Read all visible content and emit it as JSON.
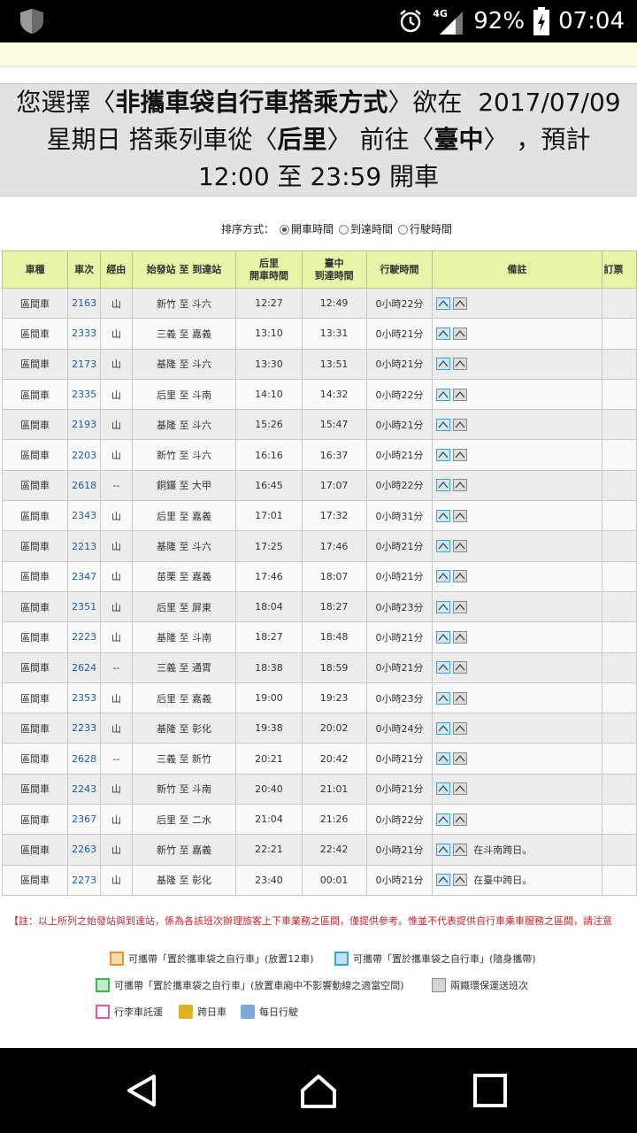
{
  "status_bar": {
    "network": "4G",
    "battery": "92%",
    "time": "07:04"
  },
  "header": {
    "line1_a": "您選擇〈",
    "line1_b": "非攜車袋自行車搭乘方式",
    "line1_c": "〉欲在",
    "date": "2017/07/09",
    "line2_a": "星期日  搭乘列車從〈",
    "from": "后里",
    "line2_b": "〉 前往〈",
    "to": "臺中",
    "line2_c": "〉 ，預計",
    "line3": "12:00  至  23:59  開車"
  },
  "sort": {
    "label": "排序方式：",
    "options": [
      "開車時間",
      "到達時間",
      "行駛時間"
    ],
    "selected": "開車時間"
  },
  "table": {
    "headers": [
      "車種",
      "車次",
      "經由",
      "始發站 至 到達站",
      "后里\n開車時間",
      "臺中\n到達時間",
      "行駛時間",
      "備註",
      "訂票"
    ],
    "rows": [
      {
        "type": "區間車",
        "no": "2163",
        "via": "山",
        "route": "新竹 至 斗六",
        "dep": "12:27",
        "arr": "12:49",
        "dur": "0小時22分",
        "note": ""
      },
      {
        "type": "區間車",
        "no": "2333",
        "via": "山",
        "route": "三義 至 嘉義",
        "dep": "13:10",
        "arr": "13:31",
        "dur": "0小時21分",
        "note": ""
      },
      {
        "type": "區間車",
        "no": "2173",
        "via": "山",
        "route": "基隆 至 斗六",
        "dep": "13:30",
        "arr": "13:51",
        "dur": "0小時21分",
        "note": ""
      },
      {
        "type": "區間車",
        "no": "2335",
        "via": "山",
        "route": "后里 至 斗南",
        "dep": "14:10",
        "arr": "14:32",
        "dur": "0小時22分",
        "note": ""
      },
      {
        "type": "區間車",
        "no": "2193",
        "via": "山",
        "route": "基隆 至 斗六",
        "dep": "15:26",
        "arr": "15:47",
        "dur": "0小時21分",
        "note": ""
      },
      {
        "type": "區間車",
        "no": "2203",
        "via": "山",
        "route": "新竹 至 斗六",
        "dep": "16:16",
        "arr": "16:37",
        "dur": "0小時21分",
        "note": ""
      },
      {
        "type": "區間車",
        "no": "2618",
        "via": "--",
        "route": "銅鑼 至 大甲",
        "dep": "16:45",
        "arr": "17:07",
        "dur": "0小時22分",
        "note": ""
      },
      {
        "type": "區間車",
        "no": "2343",
        "via": "山",
        "route": "后里 至 嘉義",
        "dep": "17:01",
        "arr": "17:32",
        "dur": "0小時31分",
        "note": ""
      },
      {
        "type": "區間車",
        "no": "2213",
        "via": "山",
        "route": "基隆 至 斗六",
        "dep": "17:25",
        "arr": "17:46",
        "dur": "0小時21分",
        "note": ""
      },
      {
        "type": "區間車",
        "no": "2347",
        "via": "山",
        "route": "苗栗 至 嘉義",
        "dep": "17:46",
        "arr": "18:07",
        "dur": "0小時21分",
        "note": ""
      },
      {
        "type": "區間車",
        "no": "2351",
        "via": "山",
        "route": "后里 至 屏東",
        "dep": "18:04",
        "arr": "18:27",
        "dur": "0小時23分",
        "note": ""
      },
      {
        "type": "區間車",
        "no": "2223",
        "via": "山",
        "route": "基隆 至 斗南",
        "dep": "18:27",
        "arr": "18:48",
        "dur": "0小時21分",
        "note": ""
      },
      {
        "type": "區間車",
        "no": "2624",
        "via": "--",
        "route": "三義 至 通霄",
        "dep": "18:38",
        "arr": "18:59",
        "dur": "0小時21分",
        "note": ""
      },
      {
        "type": "區間車",
        "no": "2353",
        "via": "山",
        "route": "后里 至 嘉義",
        "dep": "19:00",
        "arr": "19:23",
        "dur": "0小時23分",
        "note": ""
      },
      {
        "type": "區間車",
        "no": "2233",
        "via": "山",
        "route": "基隆 至 彰化",
        "dep": "19:38",
        "arr": "20:02",
        "dur": "0小時24分",
        "note": ""
      },
      {
        "type": "區間車",
        "no": "2628",
        "via": "--",
        "route": "三義 至 新竹",
        "dep": "20:21",
        "arr": "20:42",
        "dur": "0小時21分",
        "note": ""
      },
      {
        "type": "區間車",
        "no": "2243",
        "via": "山",
        "route": "新竹 至 斗南",
        "dep": "20:40",
        "arr": "21:01",
        "dur": "0小時21分",
        "note": ""
      },
      {
        "type": "區間車",
        "no": "2367",
        "via": "山",
        "route": "后里 至 二水",
        "dep": "21:04",
        "arr": "21:26",
        "dur": "0小時22分",
        "note": ""
      },
      {
        "type": "區間車",
        "no": "2263",
        "via": "山",
        "route": "新竹 至 嘉義",
        "dep": "22:21",
        "arr": "22:42",
        "dur": "0小時21分",
        "note": "在斗南跨日。"
      },
      {
        "type": "區間車",
        "no": "2273",
        "via": "山",
        "route": "基隆 至 彰化",
        "dep": "23:40",
        "arr": "00:01",
        "dur": "0小時21分",
        "note": "在臺中跨日。"
      }
    ]
  },
  "footnote": "【註：以上所列之始發站與到達站，係為各該班次辦理旅客上下車業務之區間，僅提供參考。惟並不代表提供自行車乘車服務之區間，請注意",
  "legend": [
    {
      "label": "可攜帶「置於攜車袋之自行車」(放置12車)",
      "color": "#e8932c"
    },
    {
      "label": "可攜帶「置於攜車袋之自行車」(隨身攜帶)",
      "color": "#3aa3d8"
    },
    {
      "label": "可攜帶「置於攜車袋之自行車」(放置車廂中不影響動線之適當空間)",
      "color": "#3ab54a"
    },
    {
      "label": "兩鐵環保運送班次",
      "color": "#8a8a8a"
    },
    {
      "label": "行李車託運",
      "color": "#e052b0"
    },
    {
      "label": "跨日車",
      "color": "#e0b020"
    },
    {
      "label": "每日行駛",
      "color": "#7aa8d8"
    }
  ]
}
